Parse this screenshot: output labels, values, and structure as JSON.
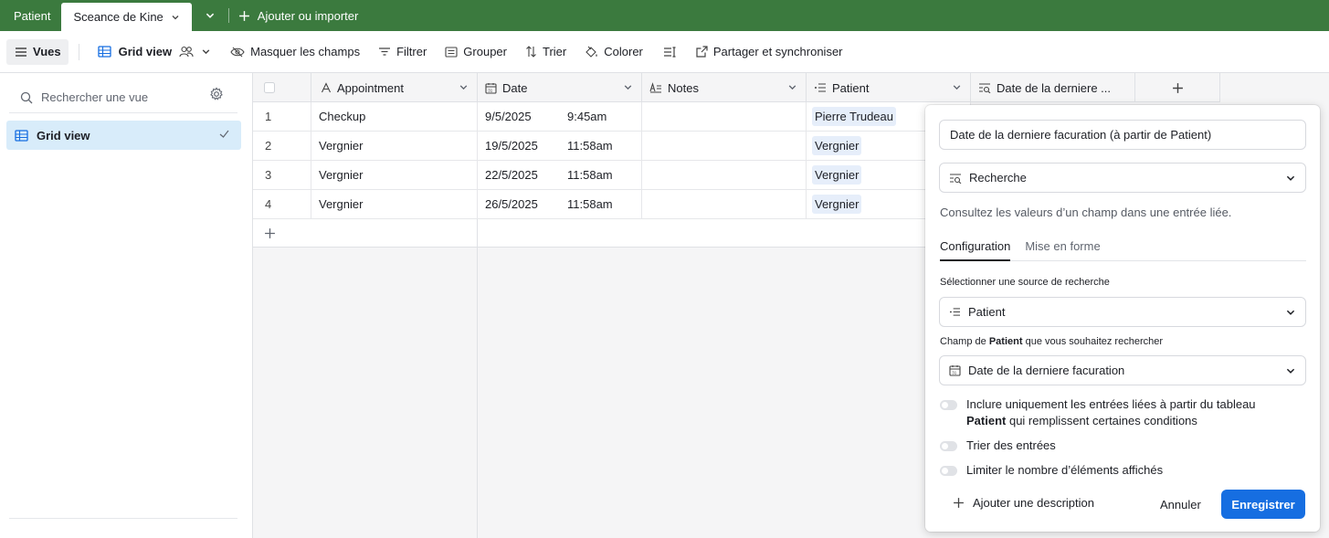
{
  "tabs": {
    "inactive": "Patient",
    "active": "Sceance de Kine",
    "add_import": "Ajouter ou importer"
  },
  "toolbar": {
    "views": "Vues",
    "view_name": "Grid view",
    "hide_fields": "Masquer les champs",
    "filter": "Filtrer",
    "group": "Grouper",
    "sort": "Trier",
    "color": "Colorer",
    "share": "Partager et synchroniser"
  },
  "sidebar": {
    "search_placeholder": "Rechercher une vue",
    "views": [
      {
        "label": "Grid view",
        "selected": true
      }
    ]
  },
  "grid": {
    "columns": [
      "Appointment",
      "Date",
      "Notes",
      "Patient",
      "Date de la derniere ..."
    ],
    "rows": [
      {
        "num": "1",
        "appointment": "Checkup",
        "date": "9/5/2025",
        "time": "9:45am",
        "notes": "",
        "patient": "Pierre Trudeau"
      },
      {
        "num": "2",
        "appointment": "Vergnier",
        "date": "19/5/2025",
        "time": "11:58am",
        "notes": "",
        "patient": "Vergnier"
      },
      {
        "num": "3",
        "appointment": "Vergnier",
        "date": "22/5/2025",
        "time": "11:58am",
        "notes": "",
        "patient": "Vergnier"
      },
      {
        "num": "4",
        "appointment": "Vergnier",
        "date": "26/5/2025",
        "time": "11:58am",
        "notes": "",
        "patient": "Vergnier"
      }
    ]
  },
  "panel": {
    "field_name": "Date de la derniere facuration (à partir de Patient)",
    "field_type": "Recherche",
    "description": "Consultez les valeurs d’un champ dans une entrée liée.",
    "tab_config": "Configuration",
    "tab_format": "Mise en forme",
    "source_label": "Sélectionner une source de recherche",
    "source_value": "Patient",
    "field_label_prefix": "Champ de",
    "field_label_bold": "Patient",
    "field_label_suffix": "que vous souhaitez rechercher",
    "lookup_field": "Date de la derniere facuration",
    "toggle1_a": "Inclure uniquement les entrées liées à partir du tableau",
    "toggle1_bold": "Patient",
    "toggle1_b": "qui remplissent certaines conditions",
    "toggle2": "Trier des entrées",
    "toggle3": "Limiter le nombre d’éléments affichés",
    "add_description": "Ajouter une description",
    "cancel": "Annuler",
    "save": "Enregistrer"
  },
  "colors": {
    "tabbar": "#3b7a3e",
    "primary": "#166ee1",
    "selected_view": "#d8ecfa",
    "pill": "#e6eefa"
  }
}
